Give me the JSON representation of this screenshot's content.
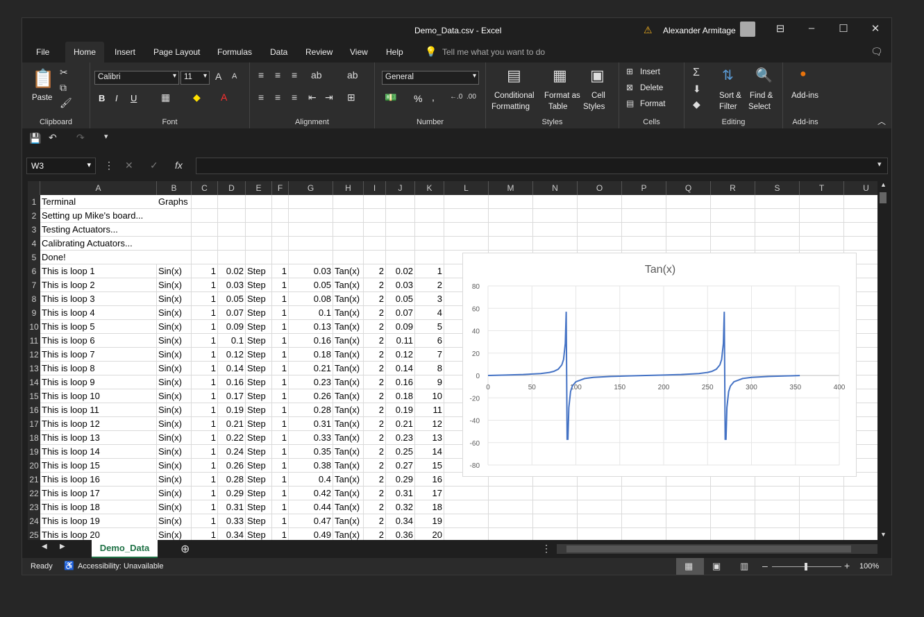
{
  "window": {
    "title": "Demo_Data.csv  -  Excel",
    "user": "Alexander Armitage"
  },
  "tabs": [
    "File",
    "Home",
    "Insert",
    "Page Layout",
    "Formulas",
    "Data",
    "Review",
    "View",
    "Help"
  ],
  "tell_me": "Tell me what you want to do",
  "ribbon": {
    "clipboard": {
      "label": "Clipboard",
      "paste": "Paste"
    },
    "font": {
      "label": "Font",
      "family": "Calibri",
      "size": "11",
      "bold": "B",
      "italic": "I",
      "underline": "U"
    },
    "alignment": {
      "label": "Alignment"
    },
    "number": {
      "label": "Number",
      "format": "General",
      "percent": "%",
      "comma": ","
    },
    "styles": {
      "label": "Styles",
      "cond1": "Conditional",
      "cond2": "Formatting",
      "fmt1": "Format as",
      "fmt2": "Table",
      "cell1": "Cell",
      "cell2": "Styles"
    },
    "cells": {
      "label": "Cells",
      "insert": "Insert",
      "delete": "Delete",
      "format": "Format"
    },
    "editing": {
      "label": "Editing",
      "sort1": "Sort &",
      "sort2": "Filter",
      "find1": "Find &",
      "find2": "Select"
    },
    "addins": {
      "label": "Add-ins",
      "btn": "Add-ins"
    }
  },
  "namebox": "W3",
  "columns": [
    {
      "name": "A"
    },
    {
      "name": "B"
    },
    {
      "name": "C"
    },
    {
      "name": "D"
    },
    {
      "name": "E"
    },
    {
      "name": "F"
    },
    {
      "name": "G"
    },
    {
      "name": "H"
    },
    {
      "name": "I"
    },
    {
      "name": "J"
    },
    {
      "name": "K"
    },
    {
      "name": "L"
    },
    {
      "name": "M"
    },
    {
      "name": "N"
    },
    {
      "name": "O"
    },
    {
      "name": "P"
    },
    {
      "name": "Q"
    },
    {
      "name": "R"
    },
    {
      "name": "S"
    },
    {
      "name": "T"
    },
    {
      "name": "U"
    }
  ],
  "rows": [
    [
      "Terminal",
      "Graphs",
      "",
      "",
      "",
      "",
      "",
      "",
      "",
      "",
      ""
    ],
    [
      "Setting up Mike's board...",
      "",
      "",
      "",
      "",
      "",
      "",
      "",
      "",
      "",
      ""
    ],
    [
      "Testing Actuators...",
      "",
      "",
      "",
      "",
      "",
      "",
      "",
      "",
      "",
      ""
    ],
    [
      "Calibrating Actuators...",
      "",
      "",
      "",
      "",
      "",
      "",
      "",
      "",
      "",
      ""
    ],
    [
      "Done!",
      "",
      "",
      "",
      "",
      "",
      "",
      "",
      "",
      "",
      ""
    ],
    [
      "This is loop 1",
      "Sin(x)",
      "1",
      "0.02",
      "Step",
      "1",
      "0.03",
      "Tan(x)",
      "2",
      "0.02",
      "1"
    ],
    [
      "This is loop 2",
      "Sin(x)",
      "1",
      "0.03",
      "Step",
      "1",
      "0.05",
      "Tan(x)",
      "2",
      "0.03",
      "2"
    ],
    [
      "This is loop 3",
      "Sin(x)",
      "1",
      "0.05",
      "Step",
      "1",
      "0.08",
      "Tan(x)",
      "2",
      "0.05",
      "3"
    ],
    [
      "This is loop 4",
      "Sin(x)",
      "1",
      "0.07",
      "Step",
      "1",
      "0.1",
      "Tan(x)",
      "2",
      "0.07",
      "4"
    ],
    [
      "This is loop 5",
      "Sin(x)",
      "1",
      "0.09",
      "Step",
      "1",
      "0.13",
      "Tan(x)",
      "2",
      "0.09",
      "5"
    ],
    [
      "This is loop 6",
      "Sin(x)",
      "1",
      "0.1",
      "Step",
      "1",
      "0.16",
      "Tan(x)",
      "2",
      "0.11",
      "6"
    ],
    [
      "This is loop 7",
      "Sin(x)",
      "1",
      "0.12",
      "Step",
      "1",
      "0.18",
      "Tan(x)",
      "2",
      "0.12",
      "7"
    ],
    [
      "This is loop 8",
      "Sin(x)",
      "1",
      "0.14",
      "Step",
      "1",
      "0.21",
      "Tan(x)",
      "2",
      "0.14",
      "8"
    ],
    [
      "This is loop 9",
      "Sin(x)",
      "1",
      "0.16",
      "Step",
      "1",
      "0.23",
      "Tan(x)",
      "2",
      "0.16",
      "9"
    ],
    [
      "This is loop 10",
      "Sin(x)",
      "1",
      "0.17",
      "Step",
      "1",
      "0.26",
      "Tan(x)",
      "2",
      "0.18",
      "10"
    ],
    [
      "This is loop 11",
      "Sin(x)",
      "1",
      "0.19",
      "Step",
      "1",
      "0.28",
      "Tan(x)",
      "2",
      "0.19",
      "11"
    ],
    [
      "This is loop 12",
      "Sin(x)",
      "1",
      "0.21",
      "Step",
      "1",
      "0.31",
      "Tan(x)",
      "2",
      "0.21",
      "12"
    ],
    [
      "This is loop 13",
      "Sin(x)",
      "1",
      "0.22",
      "Step",
      "1",
      "0.33",
      "Tan(x)",
      "2",
      "0.23",
      "13"
    ],
    [
      "This is loop 14",
      "Sin(x)",
      "1",
      "0.24",
      "Step",
      "1",
      "0.35",
      "Tan(x)",
      "2",
      "0.25",
      "14"
    ],
    [
      "This is loop 15",
      "Sin(x)",
      "1",
      "0.26",
      "Step",
      "1",
      "0.38",
      "Tan(x)",
      "2",
      "0.27",
      "15"
    ],
    [
      "This is loop 16",
      "Sin(x)",
      "1",
      "0.28",
      "Step",
      "1",
      "0.4",
      "Tan(x)",
      "2",
      "0.29",
      "16"
    ],
    [
      "This is loop 17",
      "Sin(x)",
      "1",
      "0.29",
      "Step",
      "1",
      "0.42",
      "Tan(x)",
      "2",
      "0.31",
      "17"
    ],
    [
      "This is loop 18",
      "Sin(x)",
      "1",
      "0.31",
      "Step",
      "1",
      "0.44",
      "Tan(x)",
      "2",
      "0.32",
      "18"
    ],
    [
      "This is loop 19",
      "Sin(x)",
      "1",
      "0.33",
      "Step",
      "1",
      "0.47",
      "Tan(x)",
      "2",
      "0.34",
      "19"
    ],
    [
      "This is loop 20",
      "Sin(x)",
      "1",
      "0.34",
      "Step",
      "1",
      "0.49",
      "Tan(x)",
      "2",
      "0.36",
      "20"
    ]
  ],
  "chart_data": {
    "type": "line",
    "title": "Tan(x)",
    "xlabel": "",
    "ylabel": "",
    "xlim": [
      0,
      400
    ],
    "ylim": [
      -80,
      80
    ],
    "xticks": [
      0,
      50,
      100,
      150,
      200,
      250,
      300,
      350,
      400
    ],
    "yticks": [
      80,
      60,
      40,
      20,
      0,
      -20,
      -40,
      -60,
      -80
    ],
    "grid": true,
    "series": [
      {
        "color": "#4472c4",
        "x": [
          0,
          20,
          40,
          60,
          70,
          75,
          80,
          84,
          86,
          88,
          89,
          90,
          91,
          92,
          94,
          96,
          100,
          110,
          120,
          140,
          160,
          180,
          200,
          220,
          240,
          250,
          255,
          260,
          264,
          266,
          268,
          269,
          270,
          271,
          272,
          274,
          276,
          280,
          290,
          300,
          320,
          340,
          355
        ],
        "y": [
          0,
          0.36,
          0.84,
          1.73,
          2.75,
          3.73,
          5.67,
          9.5,
          14.3,
          28.6,
          57,
          -57,
          -57,
          -28.6,
          -14.3,
          -9.5,
          -5.67,
          -2.75,
          -1.73,
          -0.84,
          -0.36,
          0,
          0.36,
          0.84,
          1.73,
          2.75,
          3.73,
          5.67,
          9.5,
          14.3,
          28.6,
          57,
          -57,
          -57,
          -28.6,
          -14.3,
          -9.5,
          -5.67,
          -2.75,
          -1.73,
          -0.84,
          -0.36,
          -0.09
        ]
      }
    ]
  },
  "sheet_tab": "Demo_Data",
  "status": {
    "ready": "Ready",
    "accessibility": "Accessibility: Unavailable",
    "zoom": "100%"
  }
}
